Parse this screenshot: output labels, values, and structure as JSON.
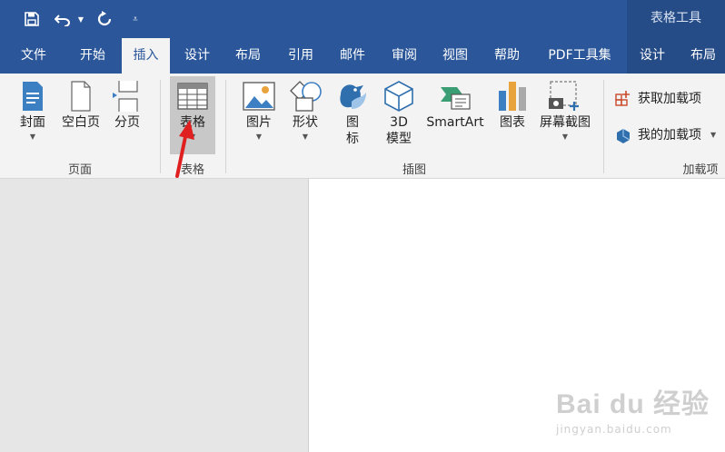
{
  "contextual": {
    "title": "表格工具"
  },
  "tabs": [
    {
      "label": "文件"
    },
    {
      "label": "开始"
    },
    {
      "label": "插入"
    },
    {
      "label": "设计"
    },
    {
      "label": "布局"
    },
    {
      "label": "引用"
    },
    {
      "label": "邮件"
    },
    {
      "label": "审阅"
    },
    {
      "label": "视图"
    },
    {
      "label": "帮助"
    },
    {
      "label": "PDF工具集"
    },
    {
      "label": "设计"
    },
    {
      "label": "布局"
    }
  ],
  "active_tab": "插入",
  "groups": {
    "pages": {
      "label": "页面",
      "cover": "封面",
      "blank": "空白页",
      "break": "分页"
    },
    "table": {
      "label": "表格",
      "table": "表格"
    },
    "illustrations": {
      "label": "插图",
      "picture": "图片",
      "shape": "形状",
      "icon_line1": "图",
      "icon_line2": "标",
      "model_line1": "3D",
      "model_line2": "模型",
      "smartart": "SmartArt",
      "chart": "图表",
      "screenshot": "屏幕截图"
    },
    "addins": {
      "label": "加载项",
      "get": "获取加载项",
      "my": "我的加载项"
    }
  },
  "watermark": {
    "brand": "Bai du 经验",
    "url": "jingyan.baidu.com"
  },
  "colors": {
    "ribbon_blue": "#2b579a",
    "contextual_blue": "#264c87",
    "ribbon_bg": "#f3f3f3",
    "arrow": "#e02020"
  }
}
